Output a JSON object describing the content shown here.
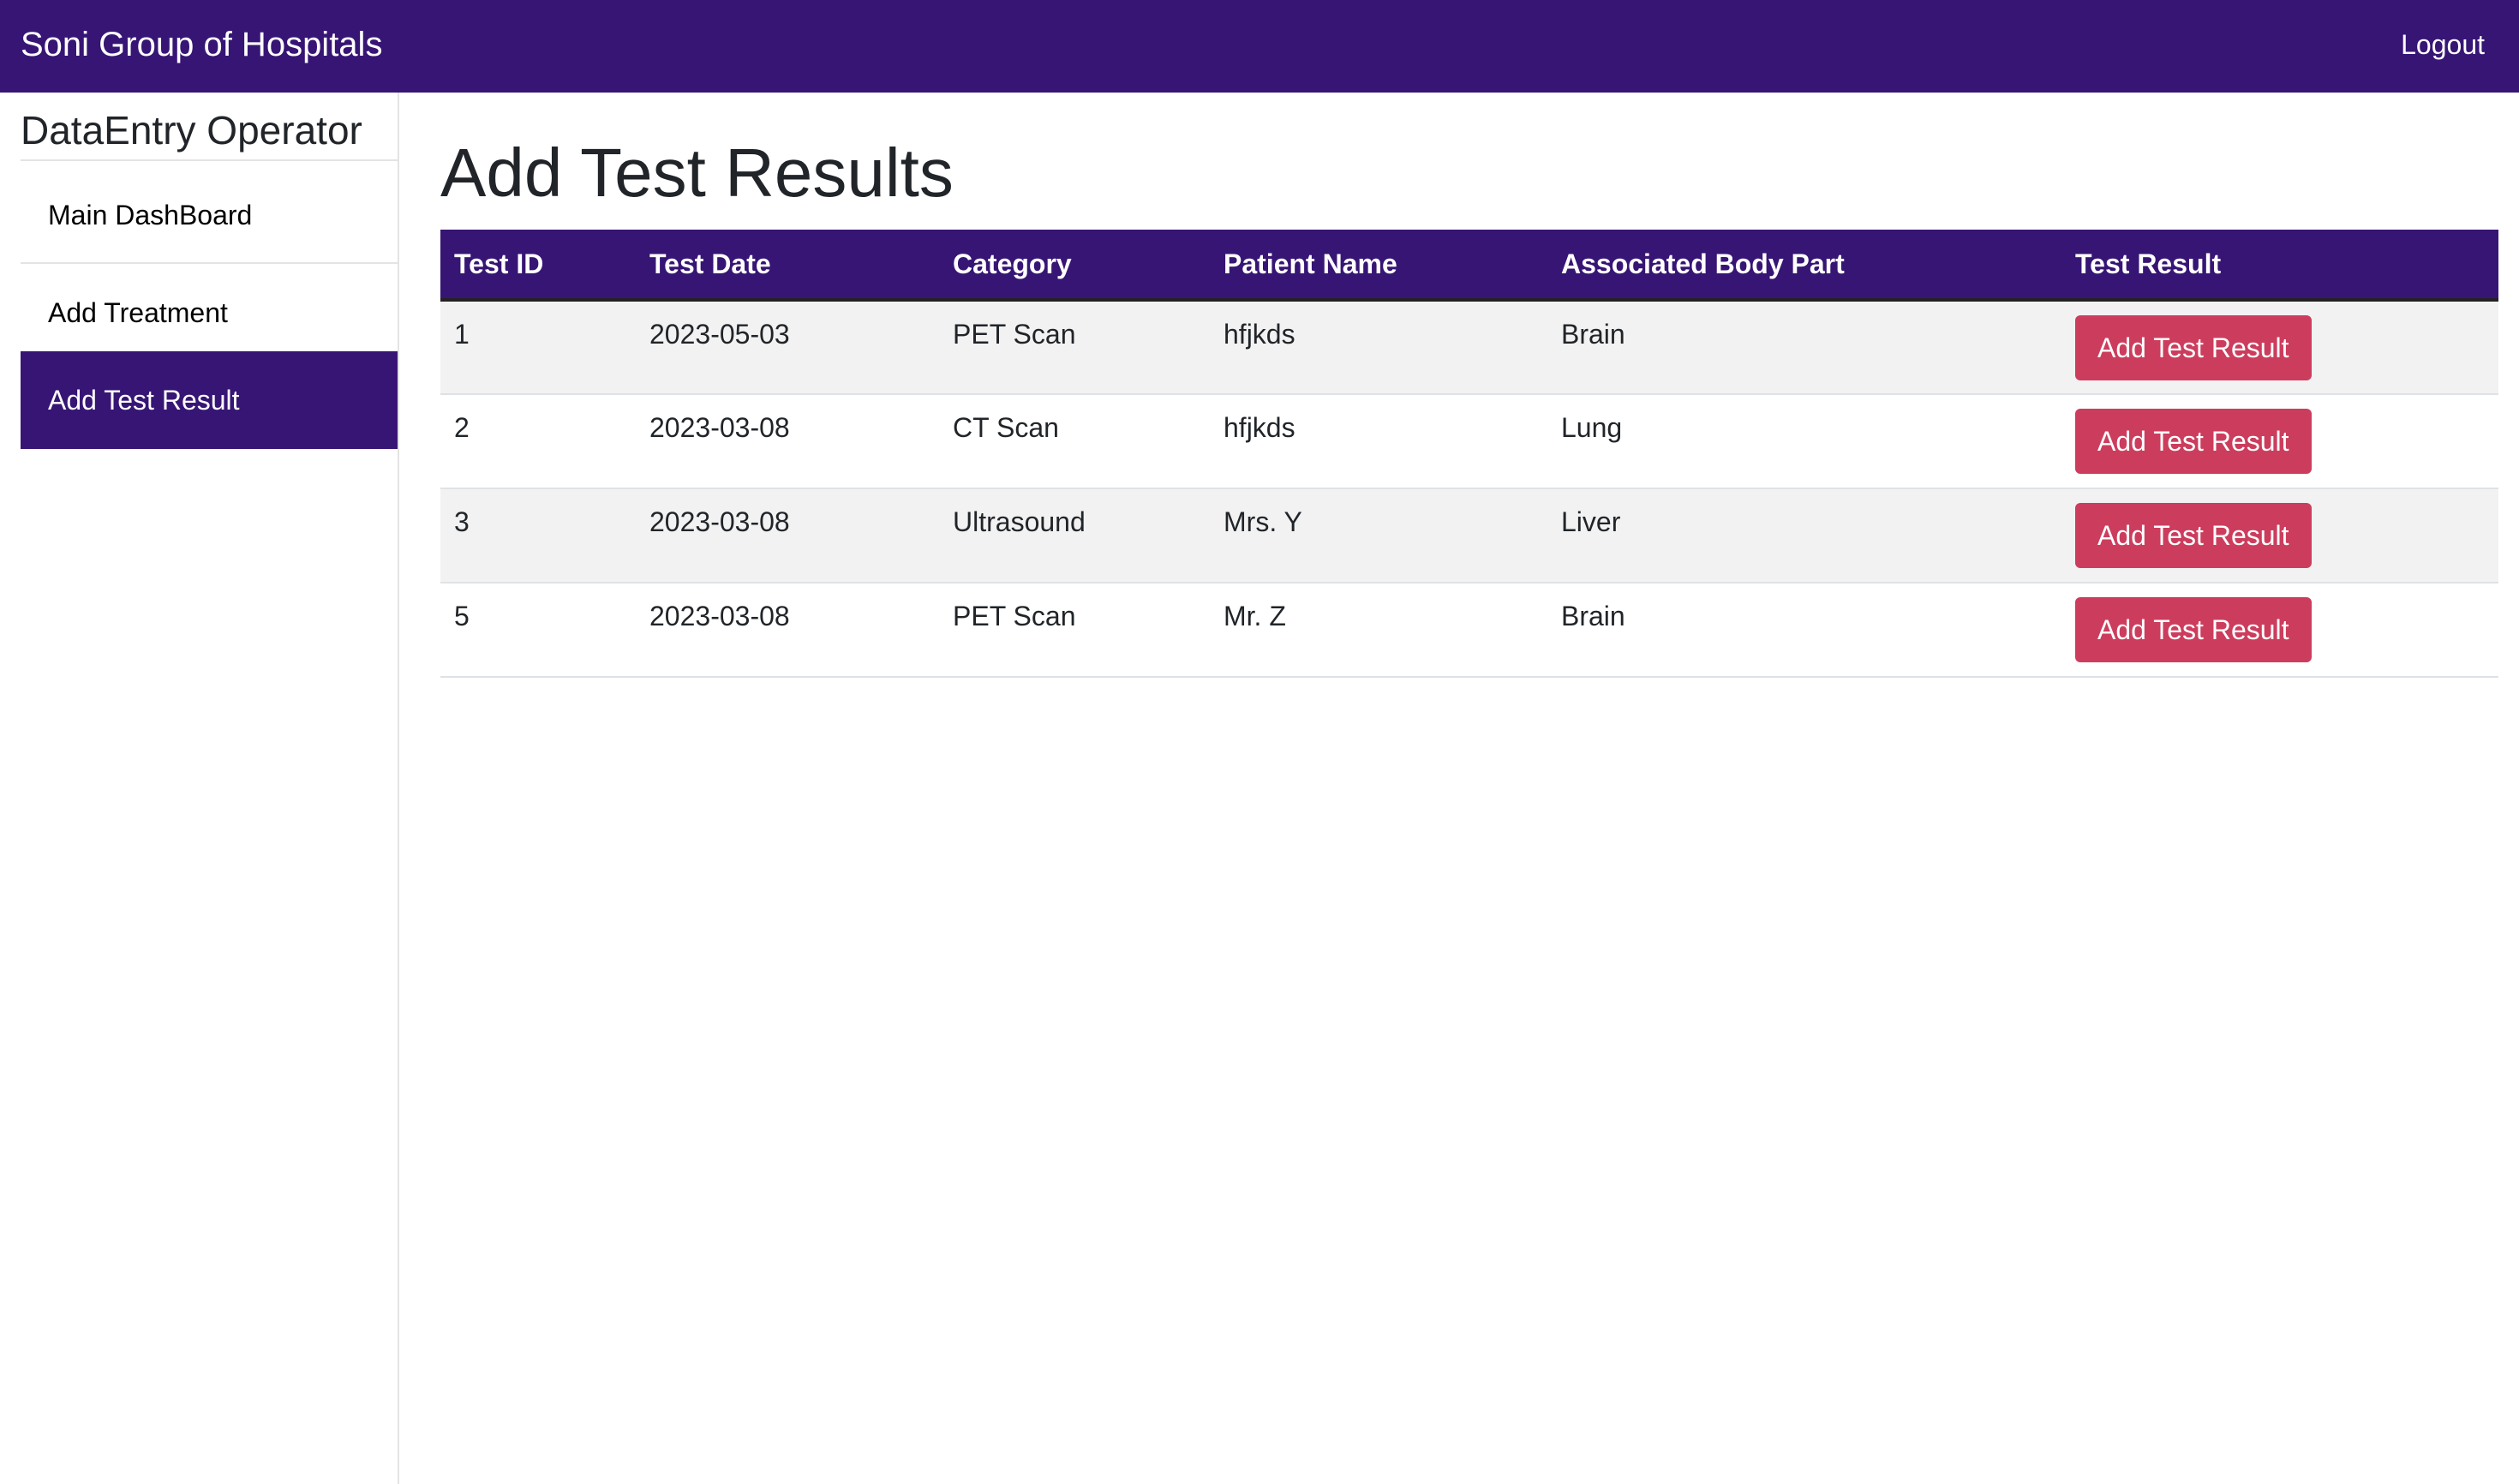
{
  "navbar": {
    "brand": "Soni Group of Hospitals",
    "logout_label": "Logout",
    "background_color": "#371574"
  },
  "sidebar": {
    "title": "DataEntry Operator",
    "items": [
      {
        "label": "Main DashBoard",
        "active": false
      },
      {
        "label": "Add Treatment",
        "active": false
      },
      {
        "label": "Add Test Result",
        "active": true
      }
    ]
  },
  "main": {
    "title": "Add Test Results",
    "table": {
      "headers": [
        "Test ID",
        "Test Date",
        "Category",
        "Patient Name",
        "Associated Body Part",
        "Test Result"
      ],
      "rows": [
        {
          "test_id": "1",
          "test_date": "2023-05-03",
          "category": "PET Scan",
          "patient_name": "hfjkds",
          "body_part": "Brain",
          "action_label": "Add Test Result"
        },
        {
          "test_id": "2",
          "test_date": "2023-03-08",
          "category": "CT Scan",
          "patient_name": "hfjkds",
          "body_part": "Lung",
          "action_label": "Add Test Result"
        },
        {
          "test_id": "3",
          "test_date": "2023-03-08",
          "category": "Ultrasound",
          "patient_name": "Mrs. Y",
          "body_part": "Liver",
          "action_label": "Add Test Result"
        },
        {
          "test_id": "5",
          "test_date": "2023-03-08",
          "category": "PET Scan",
          "patient_name": "Mr. Z",
          "body_part": "Brain",
          "action_label": "Add Test Result"
        }
      ]
    }
  },
  "colors": {
    "accent": "#371574",
    "button": "#cc3d5d",
    "row_stripe": "#f2f2f2"
  }
}
